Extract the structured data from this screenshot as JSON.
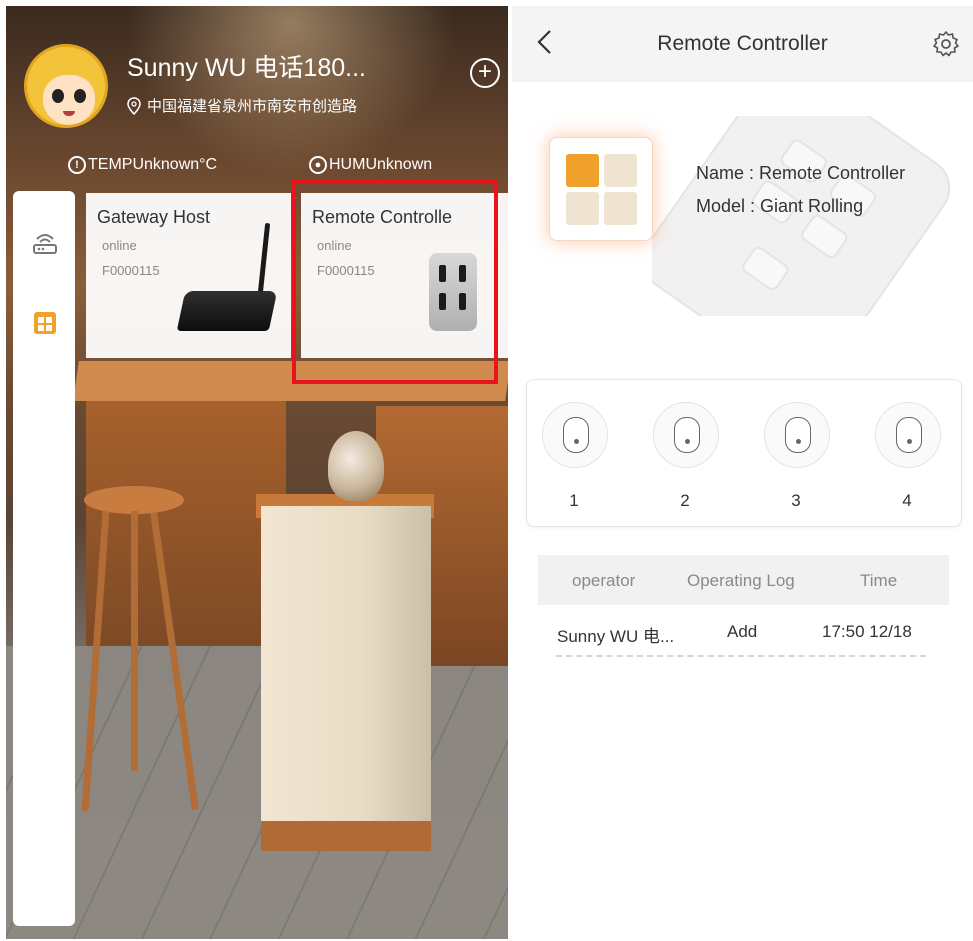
{
  "left": {
    "user_name": "Sunny WU 电话180...",
    "address": "中国福建省泉州市南安市创造路",
    "temp": "TEMPUnknown°C",
    "hum": "HUMUnknown",
    "devices": [
      {
        "title": "Gateway Host",
        "status": "online",
        "id": "F0000115"
      },
      {
        "title": "Remote Controlle",
        "status": "online",
        "id": "F0000115"
      }
    ],
    "highlight_color": "#e8131b"
  },
  "right": {
    "title": "Remote Controller",
    "name_line": "Name :  Remote Controller",
    "model_line": "Model :  Giant Rolling",
    "keys": [
      "1",
      "2",
      "3",
      "4"
    ],
    "log_headers": {
      "operator": "operator",
      "log": "Operating Log",
      "time": "Time"
    },
    "log_rows": [
      {
        "operator": "Sunny WU 电...",
        "log": "Add",
        "time": "17:50 12/18"
      }
    ],
    "accent_color": "#f0a12b"
  }
}
